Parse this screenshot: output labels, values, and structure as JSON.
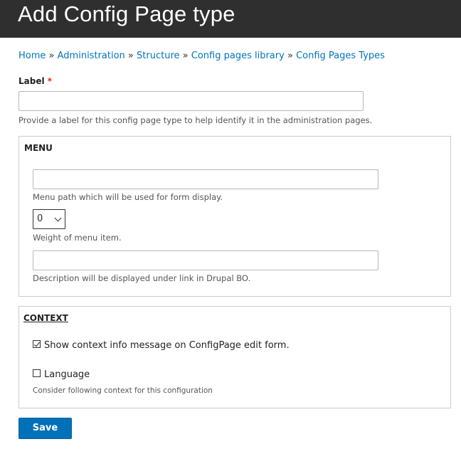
{
  "page": {
    "title": "Add Config Page type"
  },
  "breadcrumb": {
    "items": [
      "Home",
      "Administration",
      "Structure",
      "Config pages library",
      "Config Pages Types"
    ],
    "separator": "»"
  },
  "label_field": {
    "label": "Label",
    "required_marker": "*",
    "value": "",
    "description": "Provide a label for this config page type to help identify it in the administration pages."
  },
  "menu": {
    "legend": "MENU",
    "path_value": "",
    "path_description": "Menu path which will be used for form display.",
    "weight_value": "0",
    "weight_description": "Weight of menu item.",
    "desc_value": "",
    "desc_description": "Description will be displayed under link in Drupal BO."
  },
  "context": {
    "legend": "CONTEXT",
    "show_info": {
      "label": "Show context info message on ConfigPage edit form.",
      "checked": true
    },
    "language": {
      "label": "Language",
      "checked": false
    },
    "description": "Consider following context for this configuration"
  },
  "actions": {
    "save_label": "Save"
  },
  "colors": {
    "header_bg": "#2f2f2f",
    "link": "#0074bd",
    "button": "#0071b8",
    "required": "#e62600"
  }
}
